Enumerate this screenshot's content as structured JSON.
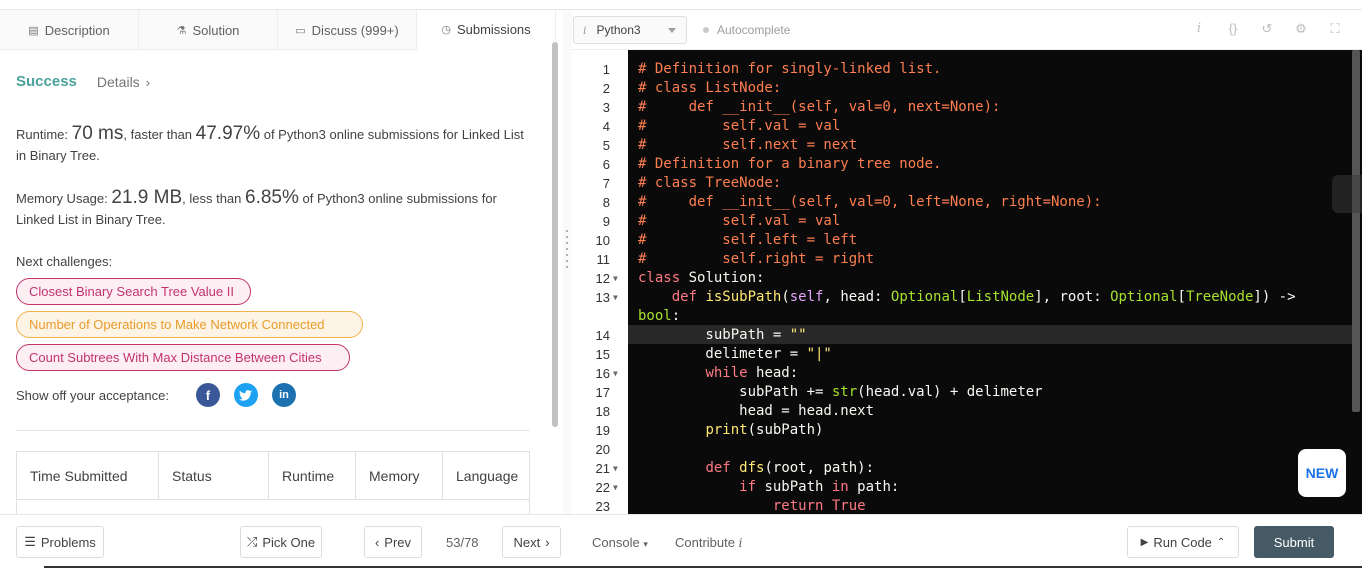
{
  "tabs": [
    {
      "label": "Description",
      "icon": "description-icon",
      "glyph": "▤"
    },
    {
      "label": "Solution",
      "icon": "flask-icon",
      "glyph": "⚗"
    },
    {
      "label": "Discuss (999+)",
      "icon": "comment-icon",
      "glyph": "▭"
    },
    {
      "label": "Submissions",
      "icon": "clock-icon",
      "glyph": "◷"
    }
  ],
  "result": {
    "status": "Success",
    "details_label": "Details",
    "runtime_label": "Runtime: ",
    "runtime_value": "70 ms",
    "runtime_mid": ", faster than ",
    "runtime_pct": "47.97%",
    "runtime_tail": " of Python3 online submissions for Linked List in Binary Tree.",
    "memory_label": "Memory Usage: ",
    "memory_value": "21.9 MB",
    "memory_mid": ", less than ",
    "memory_pct": "6.85%",
    "memory_tail": " of Python3 online submissions for Linked List in Binary Tree."
  },
  "next_challenges_label": "Next challenges:",
  "challenges": [
    "Closest Binary Search Tree Value II",
    "Number of Operations to Make Network Connected",
    "Count Subtrees With Max Distance Between Cities"
  ],
  "share_label": "Show off your acceptance:",
  "share": {
    "facebook": "f",
    "twitter": "t",
    "linkedin": "in"
  },
  "table_headers": [
    "Time Submitted",
    "Status",
    "Runtime",
    "Memory",
    "Language"
  ],
  "editor": {
    "language": "Python3",
    "autocomplete": "Autocomplete",
    "tool_icons": [
      "info-icon",
      "braces-icon",
      "undo-icon",
      "settings-icon",
      "fullscreen-icon"
    ],
    "new_badge": "NEW"
  },
  "code_lines": [
    "# Definition for singly-linked list.",
    "# class ListNode:",
    "#     def __init__(self, val=0, next=None):",
    "#         self.val = val",
    "#         self.next = next",
    "# Definition for a binary tree node.",
    "# class TreeNode:",
    "#     def __init__(self, val=0, left=None, right=None):",
    "#         self.val = val",
    "#         self.left = left",
    "#         self.right = right",
    "class Solution:",
    "    def isSubPath(self, head: Optional[ListNode], root: Optional[TreeNode]) ->",
    "bool:",
    "        subPath = \"\"",
    "        delimeter = \"|\"",
    "        while head:",
    "            subPath += str(head.val) + delimeter",
    "            head = head.next",
    "        print(subPath)",
    "",
    "        def dfs(root, path):",
    "            if subPath in path:",
    "                return True"
  ],
  "footer": {
    "problems": "Problems",
    "pick_one": "Pick One",
    "prev": "Prev",
    "page": "53/78",
    "next": "Next",
    "console": "Console",
    "contribute": "Contribute",
    "run_code": "Run Code",
    "submit": "Submit"
  }
}
